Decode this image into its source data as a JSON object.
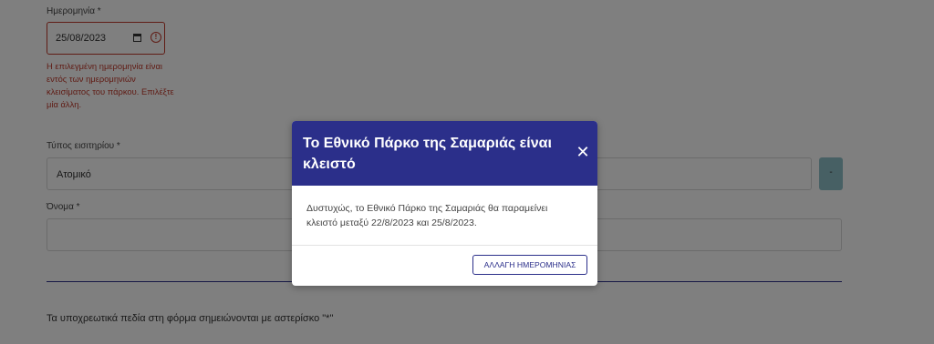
{
  "form": {
    "date_label": "Ημερομηνία *",
    "date_value": "25/08/2023",
    "date_error": "Η επιλεγμένη ημερομηνία είναι εντός των ημερομηνιών κλεισίματος του πάρκου. Επιλέξτε μία άλλη.",
    "ticket_type_label": "Τύπος εισιτηρίου *",
    "ticket_type_value": "Ατομικό",
    "side_button_label": "-",
    "name_label": "Όνομα *",
    "name_value": "",
    "required_note": "Τα υποχρεωτικά πεδία στη φόρμα σημειώνονται με αστερίσκο \"*\""
  },
  "modal": {
    "title": "Το Εθνικό Πάρκο της Σαμαριάς είναι κλειστό",
    "close_label": "✕",
    "body": "Δυστυχώς, το Εθνικό Πάρκο της Σαμαριάς θα παραμείνει κλειστό μεταξύ 22/8/2023 και 25/8/2023.",
    "button_label": "ΑΛΛΑΓΗ ΗΜΕΡΟΜΗΝΙΑΣ"
  },
  "colors": {
    "primary": "#2b2f8a",
    "error": "#c0392b",
    "secondary_button": "#8fc1c9",
    "overlay": "rgba(0,0,0,0.5)"
  },
  "icons": {
    "date_picker": "calendar-icon",
    "date_error": "error-circle-icon",
    "modal_close": "close-icon"
  }
}
